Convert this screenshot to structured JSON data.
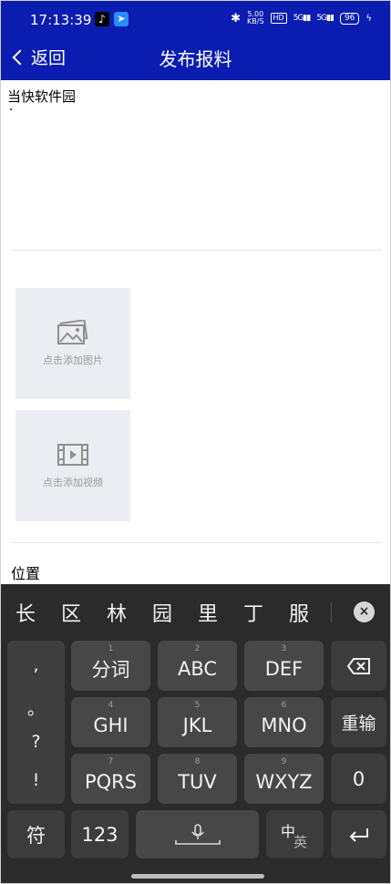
{
  "status_bar": {
    "time": "17:13:39",
    "tiktok_icon": "tiktok-icon",
    "app_icon": "blue-app-icon",
    "bluetooth": "✱",
    "speed_value": "5.00",
    "speed_unit": "KB/S",
    "hd_badge": "HD",
    "signal1": "5G",
    "signal2": "5G",
    "battery": "96",
    "charging": "ϟ"
  },
  "header": {
    "back_label": "返回",
    "title": "发布报料",
    "color": "#0a1db0"
  },
  "content": {
    "text": "当快软件园",
    "add_image_label": "点击添加图片",
    "add_video_label": "点击添加视频",
    "location_label": "位置"
  },
  "keyboard": {
    "candidates": [
      "长",
      "区",
      "林",
      "园",
      "里",
      "丁",
      "服"
    ],
    "close_label": "×",
    "punctuation": [
      ",",
      "。",
      "?",
      "!"
    ],
    "rows": [
      [
        {
          "sub": "1",
          "main": "分词"
        },
        {
          "sub": "2",
          "main": "ABC"
        },
        {
          "sub": "3",
          "main": "DEF"
        }
      ],
      [
        {
          "sub": "4",
          "main": "GHI"
        },
        {
          "sub": "5",
          "main": "JKL"
        },
        {
          "sub": "6",
          "main": "MNO"
        }
      ],
      [
        {
          "sub": "7",
          "main": "PQRS"
        },
        {
          "sub": "8",
          "main": "TUV"
        },
        {
          "sub": "9",
          "main": "WXYZ"
        }
      ]
    ],
    "delete_icon": "backspace-icon",
    "reinput_label": "重输",
    "zero_label": "0",
    "symbol_label": "符",
    "numbers_label": "123",
    "mic_icon": "microphone-icon",
    "lang_top": "中",
    "lang_bottom": "英",
    "enter_icon": "enter-icon"
  }
}
